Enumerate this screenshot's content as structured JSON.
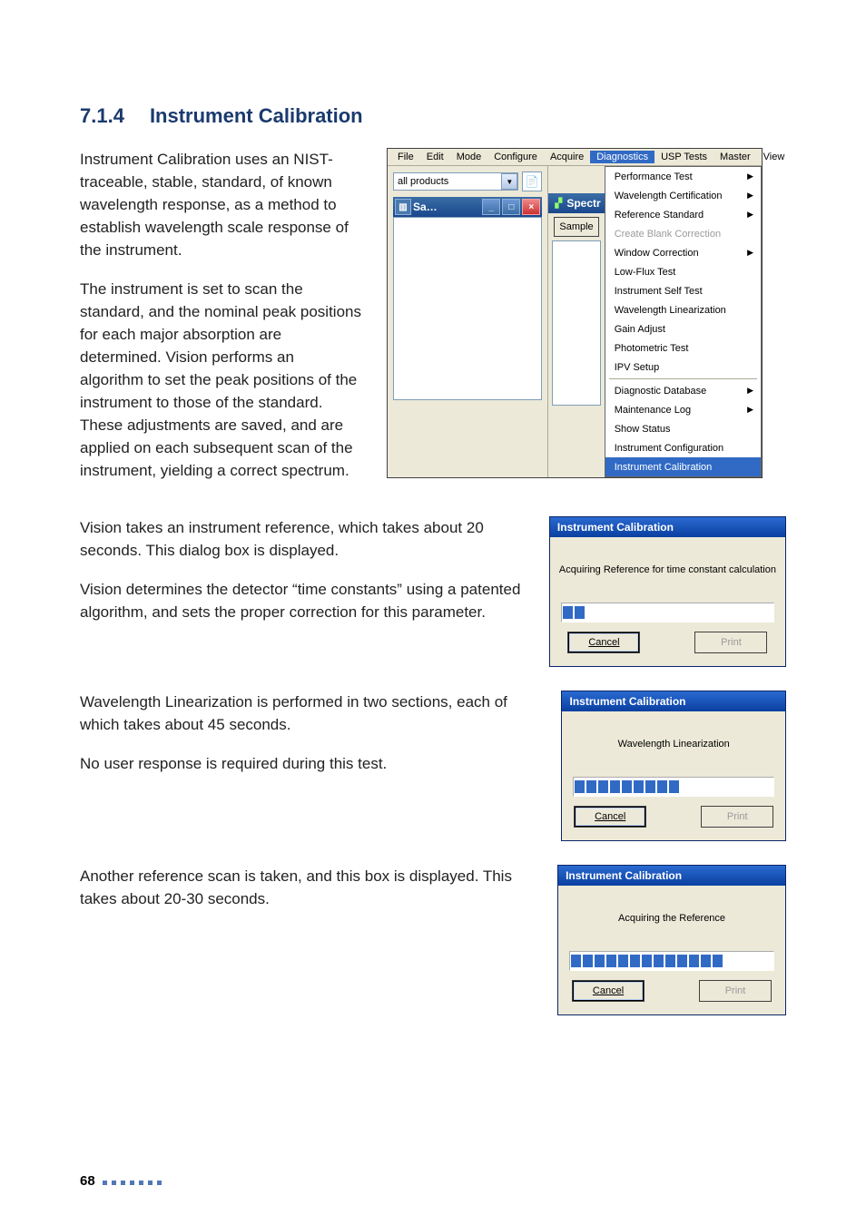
{
  "section": {
    "number": "7.1.4",
    "title": "Instrument Calibration"
  },
  "paragraphs": {
    "p1": "Instrument Calibration uses an NIST-traceable, stable, standard, of known wavelength response, as a method to establish wavelength scale response of the instrument.",
    "p2": "The instrument is set to scan the standard, and the nominal peak positions for each major absorption are determined. Vision performs an algorithm to set the peak positions of the instrument to those of the standard. These adjustments are saved, and are applied on each subsequent scan of the instrument, yielding a correct spectrum.",
    "p3": "Vision takes an instrument reference, which takes about 20 seconds. This dialog box is displayed.",
    "p4": "Vision determines the detector “time constants” using a patented algorithm, and sets the proper correction for this parameter.",
    "p5": "Wavelength Linearization is performed in two sections, each of which takes about 45 seconds.",
    "p6": "No user response is required during this test.",
    "p7": "Another reference scan is taken, and this box is displayed. This takes about 20-30 seconds."
  },
  "app": {
    "menus": [
      "File",
      "Edit",
      "Mode",
      "Configure",
      "Acquire",
      "Diagnostics",
      "USP Tests",
      "Master",
      "View"
    ],
    "selected_menu_index": 5,
    "product_select": "all products",
    "mini_window_title": "Sa…",
    "mid_title": "Spectr",
    "sample_tab": "Sample",
    "diagnostics_menu": {
      "group1": [
        {
          "label": "Performance Test",
          "submenu": true
        },
        {
          "label": "Wavelength Certification",
          "submenu": true
        },
        {
          "label": "Reference Standard",
          "submenu": true
        },
        {
          "label": "Create Blank Correction",
          "disabled": true
        },
        {
          "label": "Window Correction",
          "submenu": true
        },
        {
          "label": "Low-Flux Test"
        },
        {
          "label": "Instrument Self Test"
        },
        {
          "label": "Wavelength Linearization"
        },
        {
          "label": "Gain Adjust"
        },
        {
          "label": "Photometric Test"
        },
        {
          "label": "IPV Setup"
        }
      ],
      "group2": [
        {
          "label": "Diagnostic Database",
          "submenu": true
        },
        {
          "label": "Maintenance Log",
          "submenu": true
        },
        {
          "label": "Show Status"
        },
        {
          "label": "Instrument Configuration"
        },
        {
          "label": "Instrument Calibration",
          "highlight": true
        }
      ]
    }
  },
  "dialog1": {
    "title": "Instrument Calibration",
    "message": "Acquiring Reference for time constant calculation",
    "progress_blocks": 2,
    "cancel_label": "Cancel",
    "print_label": "Print"
  },
  "dialog2": {
    "title": "Instrument Calibration",
    "message": "Wavelength Linearization",
    "progress_blocks": 9,
    "cancel_label": "Cancel",
    "print_label": "Print"
  },
  "dialog3": {
    "title": "Instrument Calibration",
    "message": "Acquiring the Reference",
    "progress_blocks": 13,
    "cancel_label": "Cancel",
    "print_label": "Print"
  },
  "footer": {
    "page_number": "68"
  }
}
